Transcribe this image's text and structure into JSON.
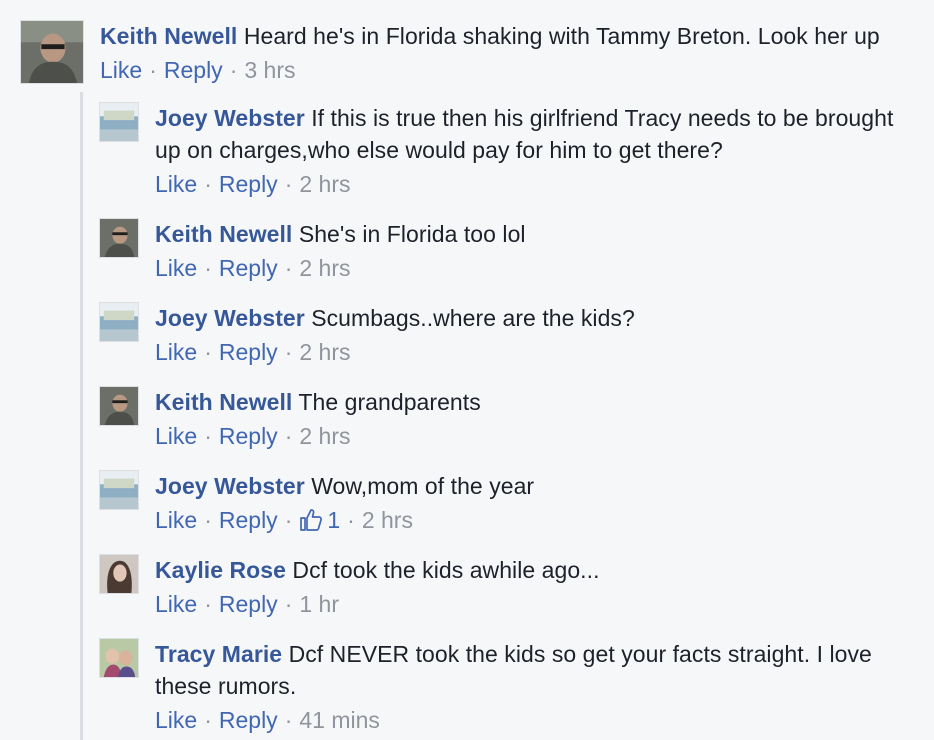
{
  "comments": [
    {
      "name": "Keith Newell",
      "text": "Heard he's in Florida shaking with Tammy Breton. Look her up",
      "like": "Like",
      "reply": "Reply",
      "time": "3 hrs"
    },
    {
      "name": "Joey Webster",
      "text": "If this is true then his girlfriend Tracy needs to be brought up on charges,who else would pay for him to get there?",
      "like": "Like",
      "reply": "Reply",
      "time": "2 hrs"
    },
    {
      "name": "Keith Newell",
      "text": "She's in Florida too lol",
      "like": "Like",
      "reply": "Reply",
      "time": "2 hrs"
    },
    {
      "name": "Joey Webster",
      "text": "Scumbags..where are the kids?",
      "like": "Like",
      "reply": "Reply",
      "time": "2 hrs"
    },
    {
      "name": "Keith Newell",
      "text": "The grandparents",
      "like": "Like",
      "reply": "Reply",
      "time": "2 hrs"
    },
    {
      "name": "Joey Webster",
      "text": "Wow,mom of the year",
      "like": "Like",
      "reply": "Reply",
      "reaction_count": "1",
      "time": "2 hrs"
    },
    {
      "name": "Kaylie Rose",
      "text": "Dcf took the kids awhile ago...",
      "like": "Like",
      "reply": "Reply",
      "time": "1 hr"
    },
    {
      "name": "Tracy Marie",
      "text": "Dcf NEVER took the kids so get your facts straight. I love these rumors.",
      "like": "Like",
      "reply": "Reply",
      "time": "41 mins"
    }
  ],
  "icons": {
    "thumbs_up": "thumbs-up-icon"
  },
  "colors": {
    "name_link": "#365899",
    "action_link": "#4267b2",
    "meta_gray": "#90949c",
    "background": "#f6f7f9"
  }
}
